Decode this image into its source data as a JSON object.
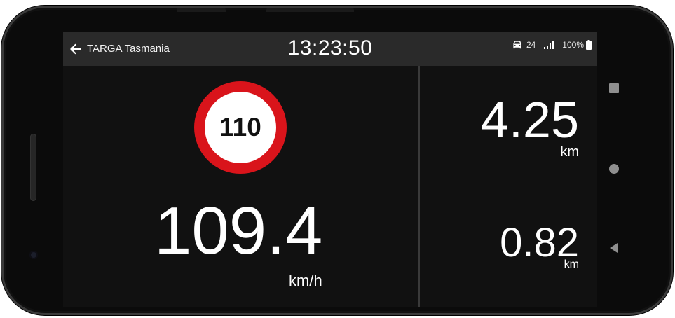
{
  "header": {
    "title": "TARGA Tasmania",
    "time": "13:23:50"
  },
  "status_bar": {
    "vehicle_icon": "car-icon",
    "count": "24",
    "signal_icon": "signal-icon",
    "battery_text": "100%",
    "battery_icon": "battery-icon"
  },
  "speed_limit": {
    "value": "110",
    "ring_color": "#d9141b"
  },
  "speed": {
    "value": "109.4",
    "unit": "km/h"
  },
  "distances": [
    {
      "value": "4.25",
      "unit": "km"
    },
    {
      "value": "0.82",
      "unit": "km"
    }
  ],
  "nav_buttons": [
    "recents-square-icon",
    "home-circle-icon",
    "back-triangle-icon"
  ],
  "colors": {
    "screen_bg": "#111111",
    "topbar_bg": "#2a2a2a",
    "accent_red": "#d9141b"
  }
}
